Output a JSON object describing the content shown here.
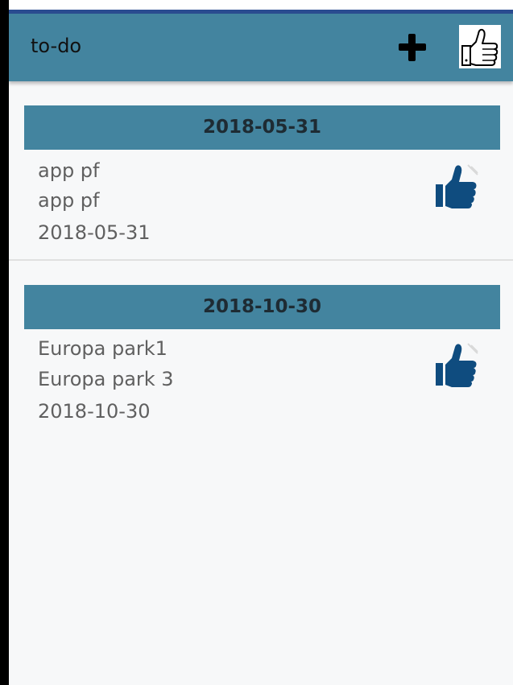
{
  "appbar": {
    "title": "to-do",
    "add_icon": "plus-icon",
    "like_icon": "thumbs-up-outline-icon"
  },
  "colors": {
    "appbar": "#43849f",
    "status_line": "#2a4c90",
    "thumb": "#0f4c7f",
    "background": "#f7f8f9"
  },
  "groups": [
    {
      "date": "2018-05-31",
      "item": {
        "title": "app pf",
        "description": "app pf",
        "date": "2018-05-31",
        "icon": "thumbs-up-icon"
      }
    },
    {
      "date": "2018-10-30",
      "item": {
        "title": "Europa park1",
        "description": "Europa park 3",
        "date": "2018-10-30",
        "icon": "thumbs-up-icon"
      }
    }
  ]
}
